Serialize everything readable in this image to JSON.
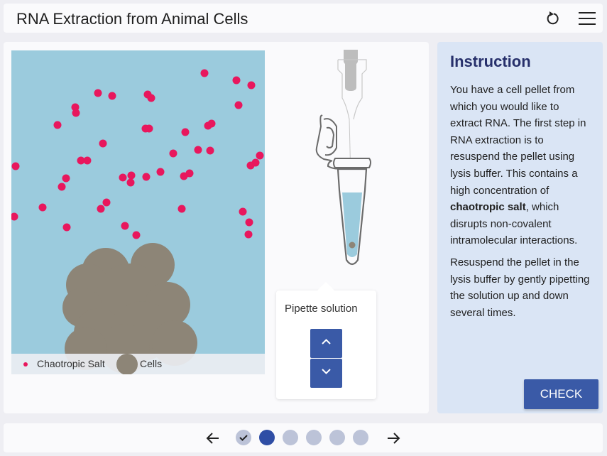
{
  "header": {
    "title": "RNA Extraction from Animal Cells"
  },
  "simulation": {
    "legend": {
      "salt_label": "Chaotropic Salt",
      "cells_label": "Cells"
    },
    "colors": {
      "background": "#9bcbdd",
      "salt": "#e8175d",
      "cells": "#8d8577"
    }
  },
  "control": {
    "label": "Pipette solution",
    "up_icon": "chevron-up-icon",
    "down_icon": "chevron-down-icon"
  },
  "instruction": {
    "heading": "Instruction",
    "paragraph1_pre": "You have a cell pellet from which you would like to extract RNA. The first step in RNA extraction is to resuspend the pellet using lysis buffer. This contains a high concentration of ",
    "paragraph1_bold": "chaotropic salt",
    "paragraph1_post": ", which disrupts non-covalent intramolecular interactions.",
    "paragraph2": "Resuspend the pellet in the lysis buffer by gently pipetting the solution up and down several times.",
    "check_label": "CHECK"
  },
  "navigation": {
    "steps": [
      {
        "state": "completed"
      },
      {
        "state": "current"
      },
      {
        "state": "pending"
      },
      {
        "state": "pending"
      },
      {
        "state": "pending"
      },
      {
        "state": "pending"
      }
    ],
    "accent": "#2f4ea5",
    "pending_color": "#bcc3d8"
  }
}
